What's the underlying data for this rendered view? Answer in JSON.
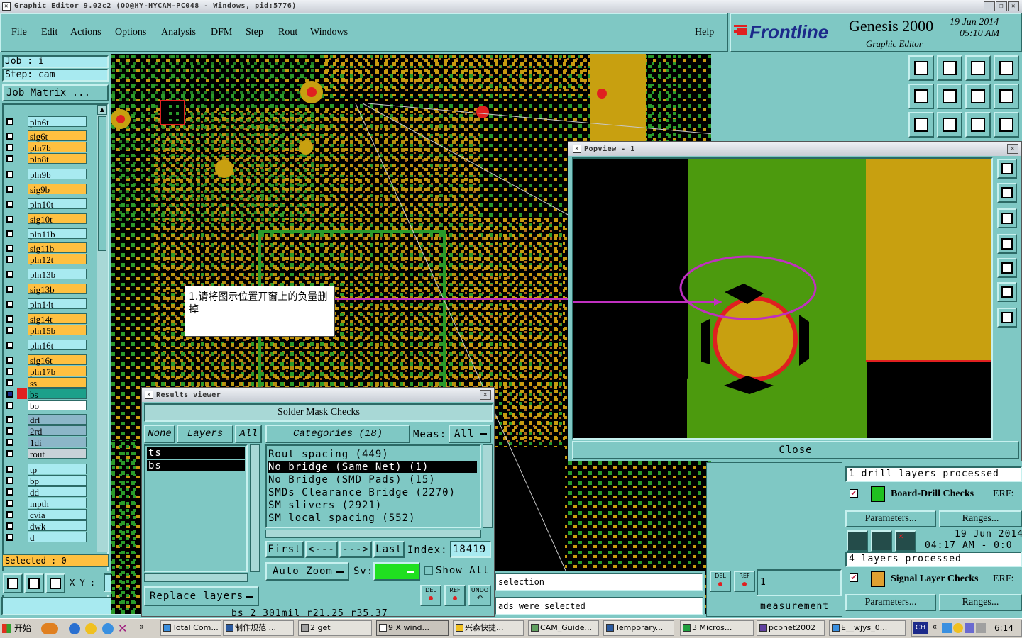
{
  "window_title": "Graphic Editor 9.02c2 (OO@HY-HYCAM-PC048 - Windows, pid:5776)",
  "menu": [
    "File",
    "Edit",
    "Actions",
    "Options",
    "Analysis",
    "DFM",
    "Step",
    "Rout",
    "Windows"
  ],
  "help": "Help",
  "brand": {
    "logo": "Frontline",
    "product": "Genesis 2000",
    "subtitle": "Graphic Editor",
    "date": "19 Jun 2014",
    "time": "05:10 AM"
  },
  "job": {
    "job_label": "Job : i",
    "step_label": "Step: cam",
    "matrix_button": "Job Matrix ..."
  },
  "layers": [
    {
      "name": "pln6t",
      "color": "c"
    },
    {
      "name": "sig6t",
      "color": "y"
    },
    {
      "name": "pln7b",
      "color": "y"
    },
    {
      "name": "pln8t",
      "color": "y"
    },
    {
      "name": "pln9b",
      "color": "c"
    },
    {
      "name": "sig9b",
      "color": "y"
    },
    {
      "name": "pln10t",
      "color": "c"
    },
    {
      "name": "sig10t",
      "color": "y"
    },
    {
      "name": "pln11b",
      "color": "c"
    },
    {
      "name": "sig11b",
      "color": "y"
    },
    {
      "name": "pln12t",
      "color": "y"
    },
    {
      "name": "pln13b",
      "color": "c"
    },
    {
      "name": "sig13b",
      "color": "y"
    },
    {
      "name": "pln14t",
      "color": "c"
    },
    {
      "name": "sig14t",
      "color": "y"
    },
    {
      "name": "pln15b",
      "color": "y"
    },
    {
      "name": "pln16t",
      "color": "c"
    },
    {
      "name": "sig16t",
      "color": "y"
    },
    {
      "name": "pln17b",
      "color": "y"
    },
    {
      "name": "ss",
      "color": "y"
    },
    {
      "name": "bs",
      "color": "teal"
    },
    {
      "name": "bo",
      "color": "w"
    },
    {
      "name": "drl",
      "color": "s"
    },
    {
      "name": "2rd",
      "color": "s"
    },
    {
      "name": "1di",
      "color": "s"
    },
    {
      "name": "rout",
      "color": "g"
    },
    {
      "name": "tp",
      "color": "c"
    },
    {
      "name": "bp",
      "color": "c"
    },
    {
      "name": "dd",
      "color": "c"
    },
    {
      "name": "mpth",
      "color": "c"
    },
    {
      "name": "cvia",
      "color": "c"
    },
    {
      "name": "dwk",
      "color": "c"
    },
    {
      "name": "d",
      "color": "c"
    }
  ],
  "selected_label": "Selected : 0",
  "xy_label": "X Y :",
  "annotation": "1.请将图示位置开窗上的负量删掉",
  "popview": {
    "title": "Popview - 1",
    "close": "Close"
  },
  "results": {
    "title": "Results viewer",
    "header": "Solder Mask Checks",
    "none": "None",
    "layers": "Layers",
    "all": "All",
    "categories": "Categories (18)",
    "meas_label": "Meas:",
    "meas_value": "All",
    "layer_list": [
      "ts",
      "bs"
    ],
    "category_list": [
      "Rout spacing (449)",
      "No bridge (Same Net) (1)",
      "No Bridge (SMD Pads) (15)",
      "SMDs Clearance Bridge (2270)",
      "SM slivers (2921)",
      "SM local spacing (552)"
    ],
    "first": "First",
    "prev": "<---",
    "next": "--->",
    "last": "Last",
    "index_label": "Index:",
    "index_value": "18419",
    "auto_zoom": "Auto Zoom",
    "sv": "Sv:",
    "show_all": "Show All",
    "replace_layers": "Replace layers",
    "del": "DEL",
    "ref": "REF",
    "undo": "UNDO",
    "status": "bs 2 301mil r21.25 r35.37"
  },
  "status_lines": [
    "selection",
    "ads were selected"
  ],
  "measure": {
    "del": "DEL",
    "ref": "REF",
    "text": "1 measurement"
  },
  "checks": {
    "drill_processed": "1 drill layers processed",
    "drill_name": "Board-Drill Checks",
    "erf": "ERF:",
    "params": "Parameters...",
    "ranges": "Ranges...",
    "drill_date": "19 Jun 2014",
    "drill_time": "04:17 AM - 0:0",
    "signal_processed": "4 layers processed",
    "signal_name": "Signal Layer Checks"
  },
  "taskbar": {
    "start": "开始",
    "items": [
      "Total Com...",
      "制作规范 ...",
      "2 get",
      "9 X wind...",
      "兴森快捷...",
      "CAM_Guide...",
      "Temporary...",
      "3 Micros...",
      "pcbnet2002",
      "E__wjys_0..."
    ],
    "lang": "CH",
    "clock": "6:14"
  }
}
